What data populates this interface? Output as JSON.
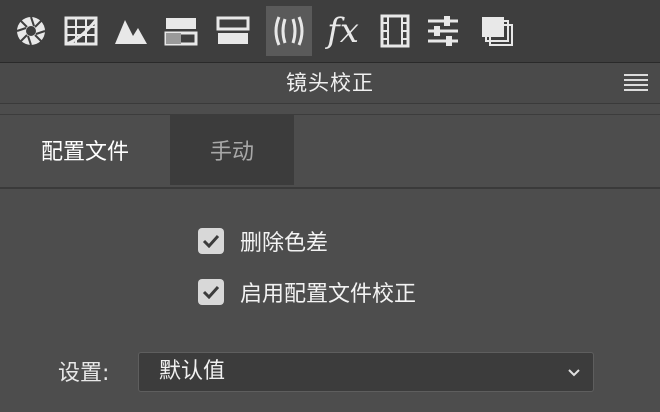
{
  "toolbar": {
    "tools": [
      {
        "icon": "aperture-icon"
      },
      {
        "icon": "grid-icon"
      },
      {
        "icon": "mountain-icon"
      },
      {
        "icon": "split-toning-icon"
      },
      {
        "icon": "detail-icon"
      },
      {
        "icon": "lens-correction-icon",
        "active": true
      },
      {
        "icon": "fx-icon",
        "label": "fx"
      },
      {
        "icon": "film-icon"
      },
      {
        "icon": "sliders-icon"
      },
      {
        "icon": "presets-icon"
      }
    ]
  },
  "panel": {
    "title": "镜头校正"
  },
  "tabs": [
    {
      "label": "配置文件",
      "active": true
    },
    {
      "label": "手动",
      "active": false
    }
  ],
  "checkboxes": [
    {
      "label": "删除色差",
      "checked": true
    },
    {
      "label": "启用配置文件校正",
      "checked": true
    }
  ],
  "settings": {
    "label": "设置:",
    "value": "默认值"
  },
  "colors": {
    "background": "#4d4d4d",
    "toolbar": "#3e3e3e",
    "active_tool": "#5a5a5a",
    "inactive_tab": "#3c3c3c"
  }
}
